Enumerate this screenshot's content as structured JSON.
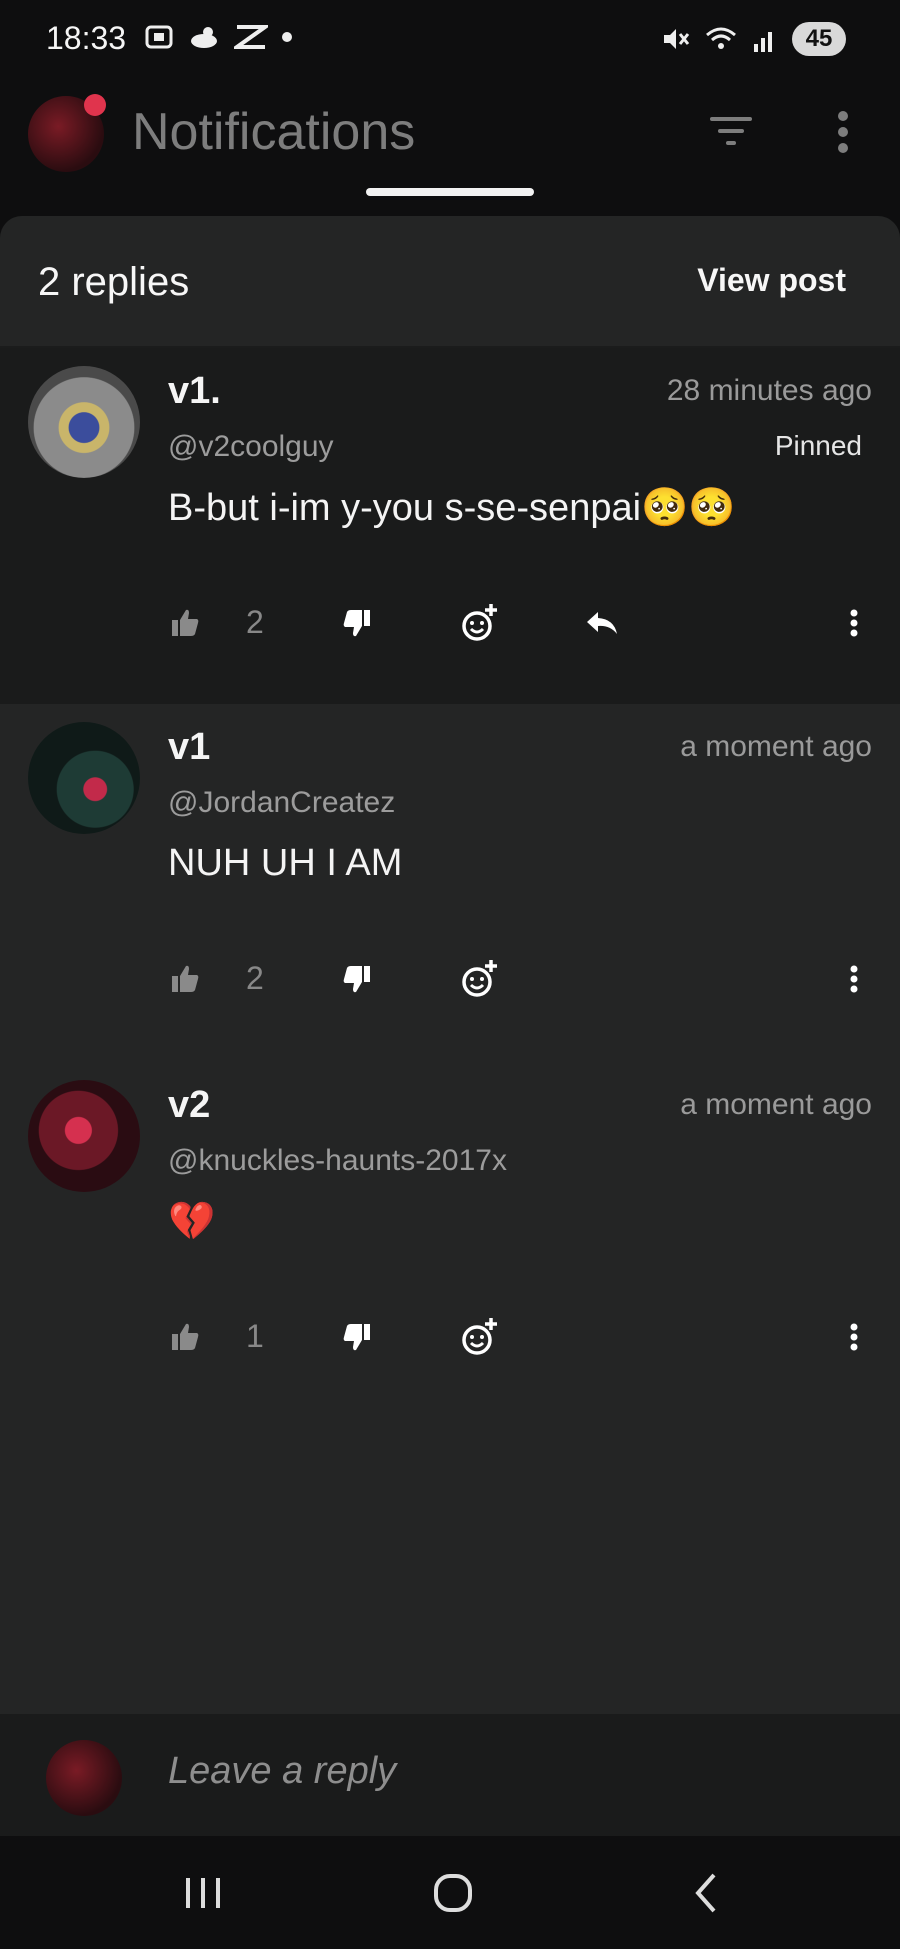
{
  "status_bar": {
    "time": "18:33",
    "battery": "45"
  },
  "app_bar": {
    "title": "Notifications"
  },
  "sheet": {
    "replies_count": "2 replies",
    "view_post_label": "View post"
  },
  "comments": [
    {
      "name": "v1.",
      "handle": "@v2coolguy",
      "time": "28 minutes ago",
      "pinned_label": "Pinned",
      "body": "B-but i-im y-you s-se-senpai🥺🥺",
      "likes": "2"
    },
    {
      "name": "v1",
      "handle": "@JordanCreatez",
      "time": "a moment ago",
      "body": "NUH UH I AM",
      "likes": "2"
    },
    {
      "name": "v2",
      "handle": "@knuckles-haunts-2017x",
      "time": "a moment ago",
      "body": "💔",
      "likes": "1"
    }
  ],
  "reply_bar": {
    "placeholder": "Leave a reply"
  },
  "colors": {
    "background": "#0e0e0f",
    "sheet": "#242525",
    "pinned_row": "#1a1b1b",
    "notification_dot": "#e0344d"
  }
}
